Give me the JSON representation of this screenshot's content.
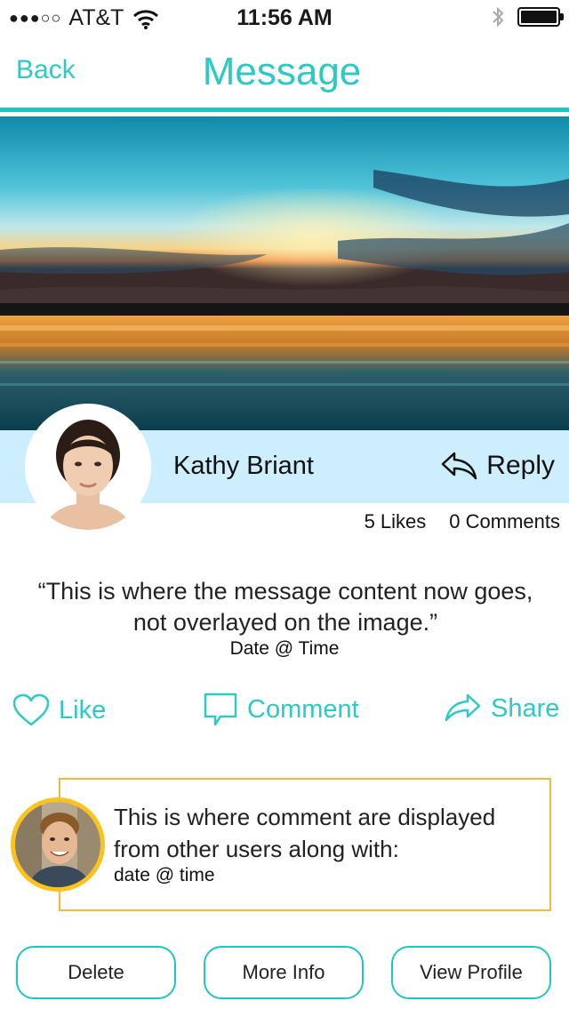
{
  "status_bar": {
    "signal": "●●●○○",
    "carrier": "AT&T",
    "time": "11:56 AM"
  },
  "nav": {
    "back_label": "Back",
    "title": "Message"
  },
  "post": {
    "author": "Kathy Briant",
    "reply_label": "Reply",
    "likes": "5 Likes",
    "comments": "0 Comments",
    "message": "“This is where the message content now goes, not overlayed on the image.”",
    "date": "Date @ Time"
  },
  "actions": {
    "like": "Like",
    "comment": "Comment",
    "share": "Share"
  },
  "comment": {
    "text": "This is where comment are displayed from other users along with:",
    "date": "date @ time"
  },
  "buttons": {
    "delete": "Delete",
    "more_info": "More Info",
    "view_profile": "View Profile"
  },
  "colors": {
    "accent": "#2ec9c4",
    "author_band": "#cdeefc",
    "comment_border": "#f4b93a",
    "comment_avatar_ring": "#fbc31b"
  }
}
